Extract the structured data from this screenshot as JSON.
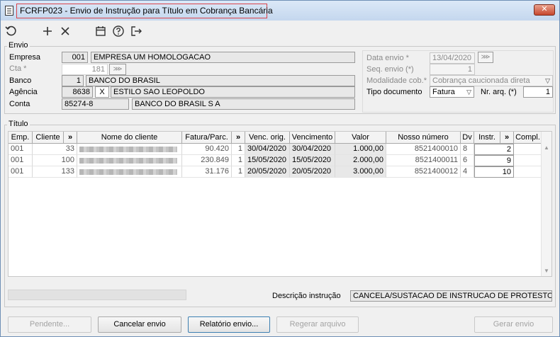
{
  "window": {
    "title": "FCRFP023 - Envio de Instrução para Título em Cobrança Bancária",
    "close_glyph": "✕"
  },
  "toolbar": {
    "icons": [
      "refresh-icon",
      "add-icon",
      "cancel-icon",
      "calendar-icon",
      "help-icon",
      "exit-icon"
    ]
  },
  "envio": {
    "group_label": "Envio",
    "empresa_label": "Empresa",
    "empresa_code": "001",
    "empresa_name": "EMPRESA UM  HOMOLOGACAO",
    "cta_label": "Cta *",
    "cta_value": "181",
    "banco_label": "Banco",
    "banco_code": "1",
    "banco_name": "BANCO DO BRASIL",
    "agencia_label": "Agência",
    "agencia_code": "8638",
    "agencia_dv": "X",
    "agencia_name": "ESTILO SAO LEOPOLDO",
    "conta_label": "Conta",
    "conta_code": "85274-8",
    "conta_name": "BANCO DO BRASIL S A",
    "data_envio_label": "Data envio *",
    "data_envio_value": "13/04/2020",
    "seq_envio_label": "Seq. envio (*)",
    "seq_envio_value": "1",
    "modalidade_label": "Modalidade cob.*",
    "modalidade_value": "Cobrança caucionada direta",
    "tipo_doc_label": "Tipo documento",
    "tipo_doc_value": "Fatura",
    "nr_arq_label": "Nr. arq. (*)",
    "nr_arq_value": "1"
  },
  "titulo": {
    "group_label": "Título",
    "columns": [
      "Emp.",
      "Cliente",
      "»",
      "Nome do cliente",
      "Fatura/Parc.",
      "»",
      "Venc. orig.",
      "Vencimento",
      "Valor",
      "Nosso número",
      "Dv",
      "Instr.",
      "»",
      "Compl."
    ],
    "rows": [
      {
        "emp": "001",
        "cliente": "33",
        "fatura": "90.420",
        "parc": "1",
        "venc_orig": "30/04/2020",
        "vencimento": "30/04/2020",
        "valor": "1.000,00",
        "nosso_numero": "8521400010",
        "dv": "8",
        "instr": "2",
        "compl": ""
      },
      {
        "emp": "001",
        "cliente": "100",
        "fatura": "230.849",
        "parc": "1",
        "venc_orig": "15/05/2020",
        "vencimento": "15/05/2020",
        "valor": "2.000,00",
        "nosso_numero": "8521400011",
        "dv": "6",
        "instr": "9",
        "compl": ""
      },
      {
        "emp": "001",
        "cliente": "133",
        "fatura": "31.176",
        "parc": "1",
        "venc_orig": "20/05/2020",
        "vencimento": "20/05/2020",
        "valor": "3.000,00",
        "nosso_numero": "8521400012",
        "dv": "4",
        "instr": "10",
        "compl": ""
      }
    ]
  },
  "footer": {
    "descricao_label": "Descrição instrução",
    "descricao_value": "CANCELA/SUSTACAO DE INSTRUCAO DE PROTESTO"
  },
  "buttons": {
    "pendente": "Pendente...",
    "cancelar": "Cancelar envio",
    "relatorio": "Relatório envio...",
    "regerar": "Regerar arquivo",
    "gerar": "Gerar envio"
  }
}
